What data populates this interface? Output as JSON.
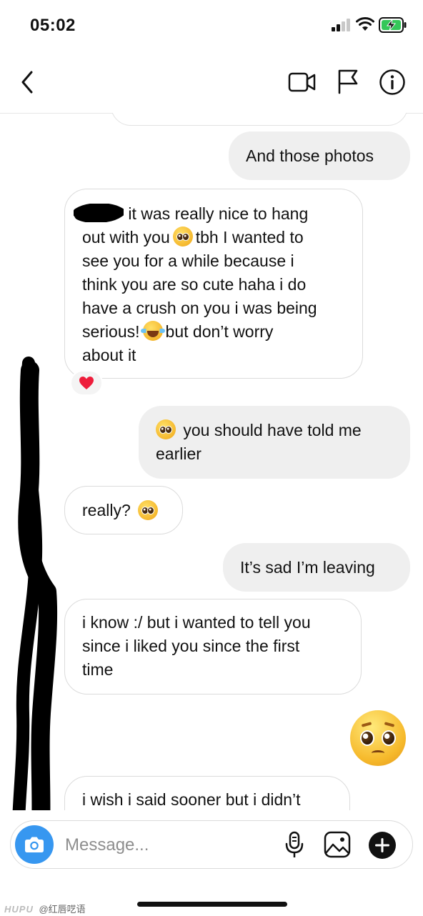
{
  "status_bar": {
    "time": "05:02"
  },
  "header": {
    "contact_name": ""
  },
  "messages": [
    {
      "direction": "outgoing",
      "parts": {
        "text": "And those photos"
      }
    },
    {
      "direction": "incoming",
      "parts": {
        "line1": "it was really nice to hang",
        "line2a": "out with you",
        "line2b": "tbh I wanted to",
        "line3": "see you for a while because i",
        "line4": "think you are so cute haha i do",
        "line5": "have a crush on you i was being",
        "line6a": "serious!",
        "line6b": "but don’t worry",
        "line7": "about it"
      },
      "reaction": "heart"
    },
    {
      "direction": "outgoing",
      "parts": {
        "line1": "you should have told me",
        "line2": "earlier"
      }
    },
    {
      "direction": "incoming",
      "parts": {
        "text": "really?"
      }
    },
    {
      "direction": "outgoing",
      "parts": {
        "text": "It’s sad I’m leaving"
      }
    },
    {
      "direction": "incoming",
      "parts": {
        "line1": "i know :/ but i wanted to tell you",
        "line2": "since i liked you since the first",
        "line3": "time"
      }
    },
    {
      "direction": "outgoing",
      "parts": {
        "emoji": "pleading-face"
      }
    },
    {
      "direction": "incoming",
      "parts": {
        "text": "i wish i said sooner but i didn’t"
      }
    }
  ],
  "composer": {
    "placeholder": "Message..."
  },
  "watermark": {
    "brand": "HUPU",
    "handle": "@红唇呓语"
  },
  "colors": {
    "accent": "#3797f0",
    "outgoing_bubble": "#efefef",
    "incoming_border": "#dbdbdb"
  }
}
